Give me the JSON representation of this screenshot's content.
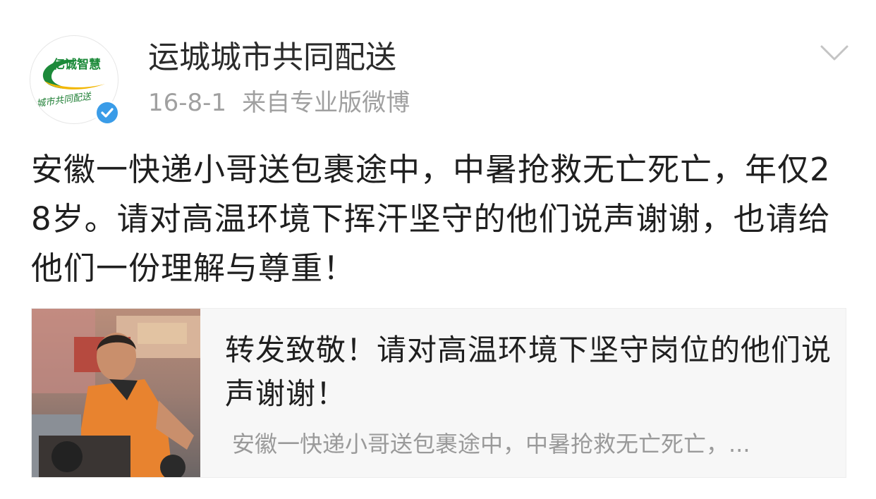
{
  "post": {
    "author": {
      "name": "运城城市共同配送",
      "avatar_logo_text": "亿诚智慧",
      "avatar_sub_text": "城市共同配送",
      "verified": true,
      "verified_color": "#3a9ce8"
    },
    "date": "16-8-1",
    "source": "来自专业版微博",
    "menu_icon": "chevron-down-icon",
    "text": "安徽一快递小哥送包裹途中，中暑抢救无亡死亡，年仅28岁。请对高温环境下挥汗坚守的他们说声谢谢，也请给他们一份理解与尊重！"
  },
  "card": {
    "title": "转发致敬！请对高温环境下坚守岗位的他们说声谢谢！",
    "summary": "安徽一快递小哥送包裹途中，中暑抢救无亡死亡，..."
  },
  "colors": {
    "text_primary": "#1f1f1f",
    "text_meta": "#a0a0a0",
    "card_bg": "#f7f7f7",
    "logo_green": "#1c8a3a",
    "logo_yellow": "#f2b705"
  }
}
